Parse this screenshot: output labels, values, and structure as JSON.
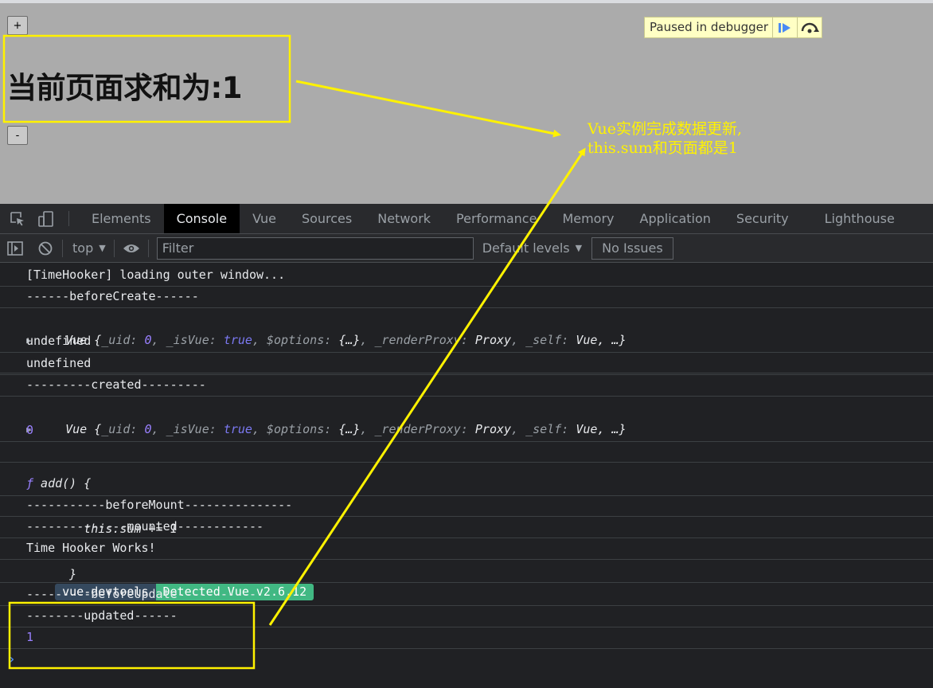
{
  "page": {
    "plus_label": "+",
    "minus_label": "-",
    "heading": "当前页面求和为:1"
  },
  "debugger": {
    "paused_text": "Paused in debugger",
    "resume_icon": "resume-icon",
    "step_over_icon": "step-over-icon"
  },
  "devtools": {
    "tabs": [
      "Elements",
      "Console",
      "Vue",
      "Sources",
      "Network",
      "Performance",
      "Memory",
      "Application",
      "Security",
      "Lighthouse"
    ],
    "active_tab": "Console",
    "toolbar": {
      "context": "top",
      "filter_placeholder": "Filter",
      "levels": "Default levels",
      "issues": "No Issues"
    }
  },
  "console": {
    "line_1": "[TimeHooker] loading outer window...",
    "line_2": "------beforeCreate------",
    "obj_prefix": "Vue {",
    "obj_uid_key": "_uid: ",
    "obj_uid_val": "0",
    "obj_isvue_key": ", _isVue: ",
    "obj_isvue_val": "true",
    "obj_options_key": ", $options: ",
    "obj_options_val": "{…}",
    "obj_proxy_key": ", _renderProxy: ",
    "obj_proxy_val": "Proxy",
    "obj_self_key": ", _self: ",
    "obj_self_val": "Vue",
    "obj_suffix": ", …}",
    "line_4": "undefined",
    "line_5": "undefined",
    "line_6": "---------created---------",
    "line_8": "0",
    "fn_f": "ƒ",
    "fn_line1": " add() {",
    "fn_line2": "        this.sum += 1",
    "fn_line3": "      }",
    "line_10": "-----------beforeMount---------------",
    "line_11": "--------------mounted------------",
    "line_12": "Time Hooker Works!",
    "badge_left": "vue-devtools",
    "badge_right": "Detected Vue v2.6.12",
    "line_14": "---------beforeUpdate-----------",
    "line_15": "--------updated------",
    "line_16": "1",
    "prompt": "›"
  },
  "annotation": {
    "line1": "Vue实例完成数据更新,",
    "line2": "this.sum和页面都是1",
    "color": "#fff200"
  }
}
